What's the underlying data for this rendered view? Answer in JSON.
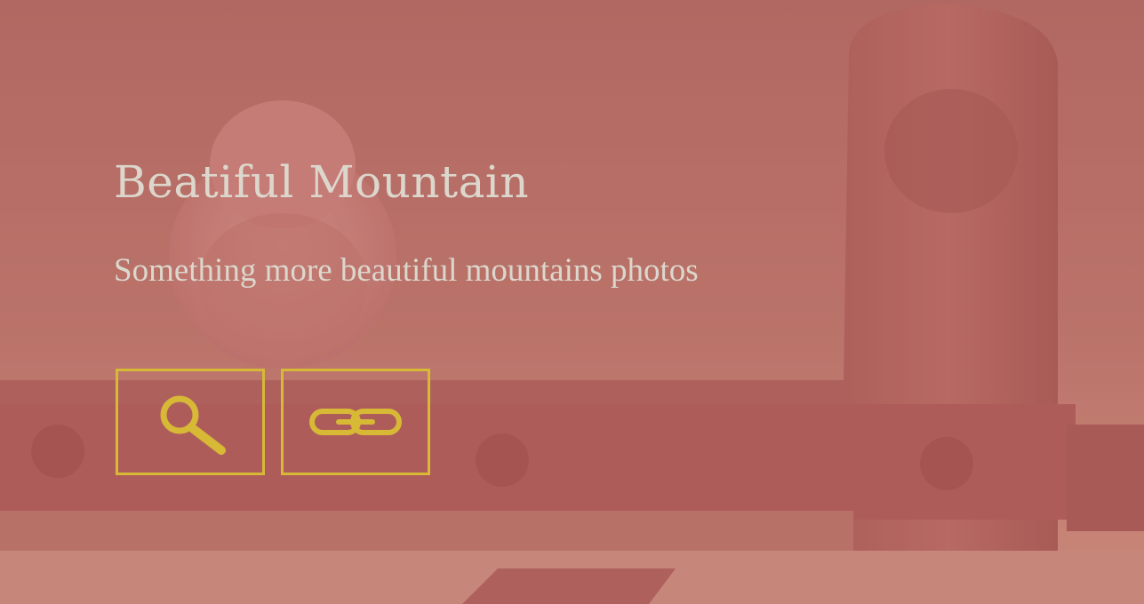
{
  "hero": {
    "title": "Beatiful Mountain",
    "subtitle": "Something more beautiful mountains photos"
  },
  "actions": [
    {
      "icon": "search-icon"
    },
    {
      "icon": "link-icon"
    }
  ],
  "colors": {
    "overlay": "#be5a5a",
    "text": "#dcd7cc",
    "accent": "#d7b936"
  }
}
